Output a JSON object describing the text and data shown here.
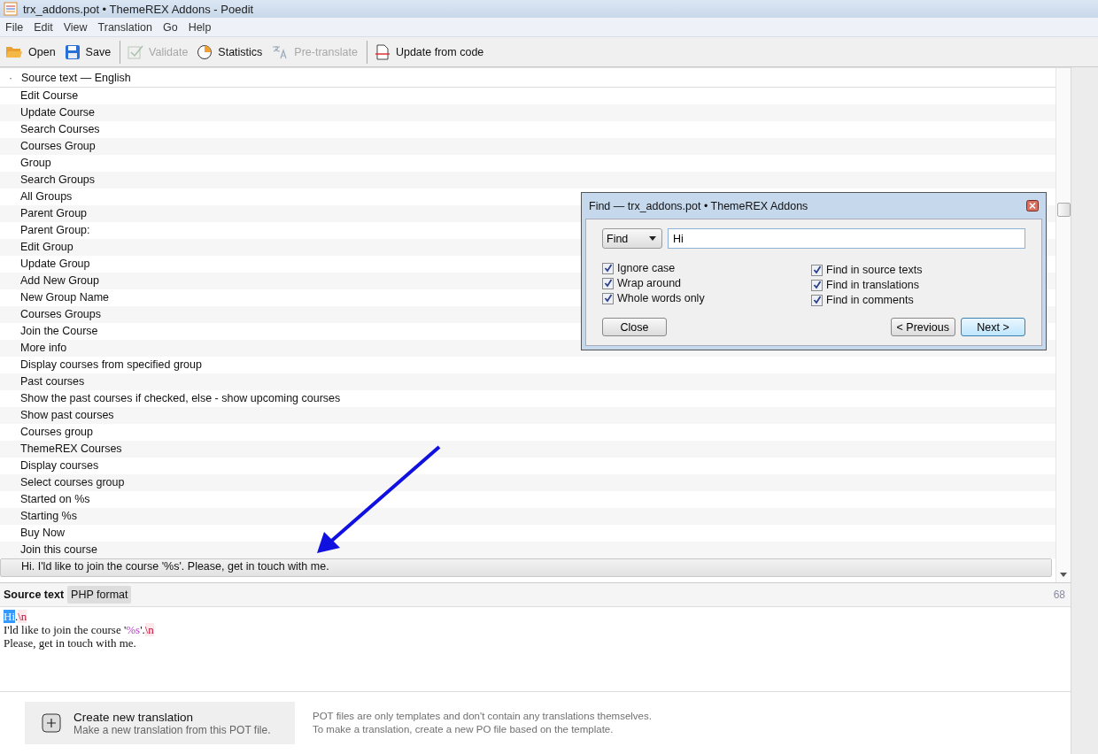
{
  "window": {
    "title": "trx_addons.pot • ThemeREX Addons - Poedit"
  },
  "menu": [
    "File",
    "Edit",
    "View",
    "Translation",
    "Go",
    "Help"
  ],
  "toolbar": [
    {
      "kind": "open",
      "label": "Open",
      "disabled": false
    },
    {
      "kind": "save",
      "label": "Save",
      "disabled": false
    },
    {
      "kind": "separator"
    },
    {
      "kind": "validate",
      "label": "Validate",
      "disabled": true
    },
    {
      "kind": "statistics",
      "label": "Statistics",
      "disabled": false
    },
    {
      "kind": "pretranslate",
      "label": "Pre-translate",
      "disabled": true
    },
    {
      "kind": "separator"
    },
    {
      "kind": "update",
      "label": "Update from code",
      "disabled": false
    }
  ],
  "list": {
    "header_mark": "·",
    "header": "Source text — English",
    "rows": [
      {
        "text": "Edit Course",
        "selected": false
      },
      {
        "text": "Update Course",
        "selected": false
      },
      {
        "text": "Search Courses",
        "selected": false
      },
      {
        "text": "Courses Group",
        "selected": false
      },
      {
        "text": "Group",
        "selected": false
      },
      {
        "text": "Search Groups",
        "selected": false
      },
      {
        "text": "All Groups",
        "selected": false
      },
      {
        "text": "Parent Group",
        "selected": false
      },
      {
        "text": "Parent Group:",
        "selected": false
      },
      {
        "text": "Edit Group",
        "selected": false
      },
      {
        "text": "Update Group",
        "selected": false
      },
      {
        "text": "Add New Group",
        "selected": false
      },
      {
        "text": "New Group Name",
        "selected": false
      },
      {
        "text": "Courses Groups",
        "selected": false
      },
      {
        "text": "Join the Course",
        "selected": false
      },
      {
        "text": "More info",
        "selected": false
      },
      {
        "text": "Display courses from specified group",
        "selected": false
      },
      {
        "text": "Past courses",
        "selected": false
      },
      {
        "text": "Show the past courses if checked, else - show upcoming courses",
        "selected": false
      },
      {
        "text": "Show past courses",
        "selected": false
      },
      {
        "text": "Courses group",
        "selected": false
      },
      {
        "text": "ThemeREX Courses",
        "selected": false
      },
      {
        "text": "Display courses",
        "selected": false
      },
      {
        "text": "Select courses group",
        "selected": false
      },
      {
        "text": "Started on %s",
        "selected": false
      },
      {
        "text": "Starting %s",
        "selected": false
      },
      {
        "text": "Buy Now",
        "selected": false
      },
      {
        "text": "Join this course",
        "selected": false
      },
      {
        "text": "Hi. I'ld like to join the course '%s'. Please, get in touch with me.",
        "selected": true
      }
    ]
  },
  "find_dialog": {
    "title": "Find — trx_addons.pot • ThemeREX Addons",
    "mode": "Find",
    "query": "Hi",
    "options_left": [
      {
        "label": "Ignore case",
        "checked": true
      },
      {
        "label": "Wrap around",
        "checked": true
      },
      {
        "label": "Whole words only",
        "checked": true
      }
    ],
    "options_right": [
      {
        "label": "Find in source texts",
        "checked": true
      },
      {
        "label": "Find in translations",
        "checked": true
      },
      {
        "label": "Find in comments",
        "checked": true
      }
    ],
    "close_button": "Close",
    "buttons": [
      {
        "label": "< Previous",
        "default": false
      },
      {
        "label": "Next >",
        "default": true
      }
    ]
  },
  "source_panel": {
    "title": "Source text",
    "tag": "PHP format",
    "count": "68",
    "lines": [
      [
        {
          "kind": "highlight",
          "text": "Hi"
        },
        {
          "kind": "plain",
          "text": "."
        },
        {
          "kind": "escape",
          "text": "\\n"
        }
      ],
      [
        {
          "kind": "plain",
          "text": "I'ld like to join the course '"
        },
        {
          "kind": "placeholder",
          "text": "%s"
        },
        {
          "kind": "plain",
          "text": "'."
        },
        {
          "kind": "escape",
          "text": "\\n"
        }
      ],
      [
        {
          "kind": "plain",
          "text": "Please, get in touch with me."
        }
      ]
    ]
  },
  "footer": {
    "action_title": "Create new translation",
    "action_subtitle": "Make a new translation from this POT file.",
    "note_lines": [
      "POT files are only templates and don't contain any translations themselves.",
      "To make a translation, create a new PO file based on the template."
    ]
  }
}
